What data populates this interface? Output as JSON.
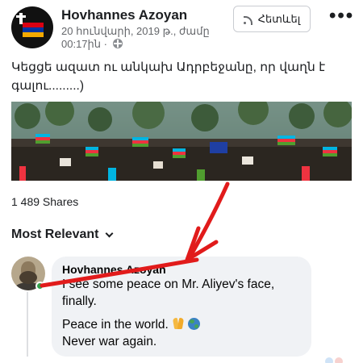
{
  "post": {
    "author": "Hovhannes Azoyan",
    "date": "20 հունվարի, 2019 թ., ժամը",
    "time": "00:17ին ·",
    "follow_label": "Հետևել",
    "more_label": "•••",
    "text": "Կեցցե ազատ ու անկախ Ադրբեջանը, որ վաղն է գալու.........)",
    "icons": {
      "privacy": "globe-icon",
      "follow": "rss-icon",
      "more": "more-horizontal-icon"
    },
    "image": {
      "description_icon": "rally-photo"
    }
  },
  "stats": {
    "shares": "1 489 Shares",
    "sort_label": "Most Relevant",
    "sort_icon": "chevron-down-icon"
  },
  "comment": {
    "author": "Hovhannes  Azoyan",
    "line1": "I see some peace on Mr. Aliyev's face,",
    "line2": "finally.",
    "line3": "Peace in the world.",
    "line4": "Never war again.",
    "emoji": [
      "folded-hands-icon",
      "earth-globe-icon"
    ],
    "online_status_color": "#31a24c"
  },
  "colors": {
    "annotation": "#e11b1b",
    "bubble": "#f0f2f5",
    "secondary_text": "#65676b"
  }
}
